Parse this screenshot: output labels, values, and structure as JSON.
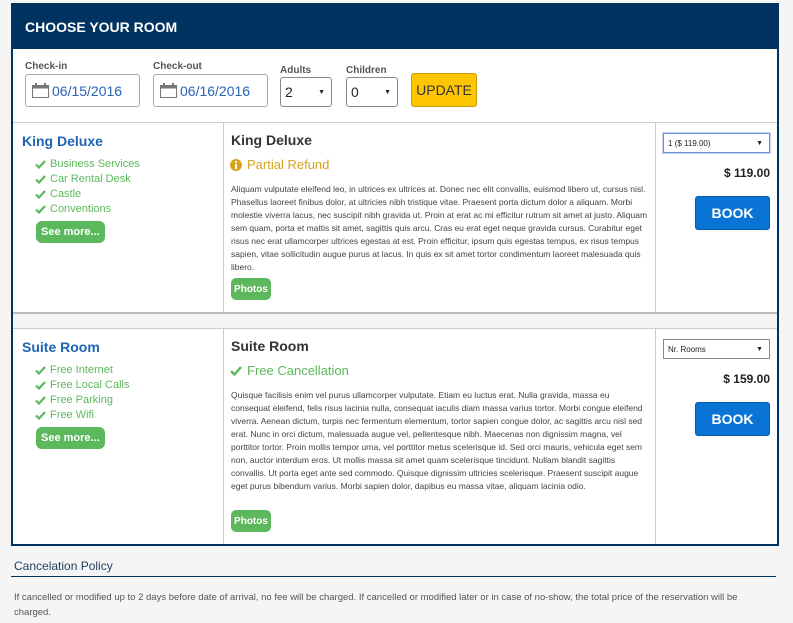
{
  "header": {
    "title": "CHOOSE YOUR ROOM"
  },
  "search": {
    "checkin_label": "Check-in",
    "checkin_value": "06/15/2016",
    "checkout_label": "Check-out",
    "checkout_value": "06/16/2016",
    "adults_label": "Adults",
    "adults_value": "2",
    "children_label": "Children",
    "children_value": "0",
    "update_label": "UPDATE",
    "calendar_icon": "calendar-icon"
  },
  "rooms": [
    {
      "name": "King Deluxe",
      "amenities": [
        "Business Services",
        "Car Rental Desk",
        "Castle",
        "Conventions"
      ],
      "see_more_label": "See more...",
      "title": "King Deluxe",
      "policy_label": "Partial Refund",
      "policy_icon": "info-circle-icon",
      "description": "Aliquam vulputate eleifend leo, in ultrices ex ultrices at. Donec nec elit convallis, euismod libero ut, cursus nisl. Phasellus laoreet finibus dolor, at ultricies nibh tristique vitae. Praesent porta dictum dolor a aliquam. Morbi molestie viverra lacus, nec suscipit nibh gravida ut. Proin at erat ac mi efficitur rutrum sit amet at justo. Aliquam sem quam, porta et mattis sit amet, sagittis quis arcu. Cras eu erat eget neque gravida cursus. Curabitur eget risus nec erat ullamcorper ultrices egestas at est. Proin efficitur, ipsum quis egestas tempus, ex risus tempus sapien, vitae sollicitudin augue purus at lacus. In quis ex sit amet tortor condimentum laoreet malesuada quis libero.",
      "photos_label": "Photos",
      "rooms_select_value": "1 ($ 119.00)",
      "price": "$ 119.00",
      "book_label": "BOOK"
    },
    {
      "name": "Suite Room",
      "amenities": [
        "Free Internet",
        "Free Local Calls",
        "Free Parking",
        "Free Wifi"
      ],
      "see_more_label": "See more...",
      "title": "Suite Room",
      "policy_label": "Free Cancellation",
      "policy_icon": "check-icon",
      "description": "Quisque facilisis enim vel purus ullamcorper vulputate. Etiam eu luctus erat. Nulla gravida, massa eu consequat eleifend, felis risus lacinia nulla, consequat iaculis diam massa varius tortor. Morbi congue eleifend viverra. Aenean dictum, turpis nec fermentum elementum, tortor sapien congue dolor, ac sagittis arcu nisl sed erat. Nunc in orci dictum, malesuada augue vel, pellentesque nibh. Maecenas non dignissim magna, vel porttitor tortor. Proin mollis tempor urna, vel porttitor metus scelerisque id. Sed orci mauris, vehicula eget sem non, auctor interdum eros. Ut mollis massa sit amet quam scelerisque tincidunt. Nullam blandit sagittis convallis. Ut porta eget ante sed commodo. Quisque dignissim ultricies scelerisque. Praesent suscipit augue eget purus bibendum varius. Morbi sapien dolor, dapibus eu massa vitae, aliquam lacinia odio.",
      "photos_label": "Photos",
      "rooms_select_value": "Nr. Rooms",
      "price": "$ 159.00",
      "book_label": "BOOK"
    }
  ],
  "cancellation": {
    "title": "Cancelation Policy",
    "text": "If cancelled or modified up to 2 days before date of arrival, no fee will be charged. If cancelled or modified later or in case of no-show, the total price of the reservation will be charged."
  },
  "colors": {
    "header_bg": "#003360",
    "accent_blue": "#1e64b4",
    "update_yellow": "#fdc600",
    "book_blue": "#0a74d6",
    "amenity_green": "#5cb85c",
    "partial_refund": "#d6a31b"
  }
}
